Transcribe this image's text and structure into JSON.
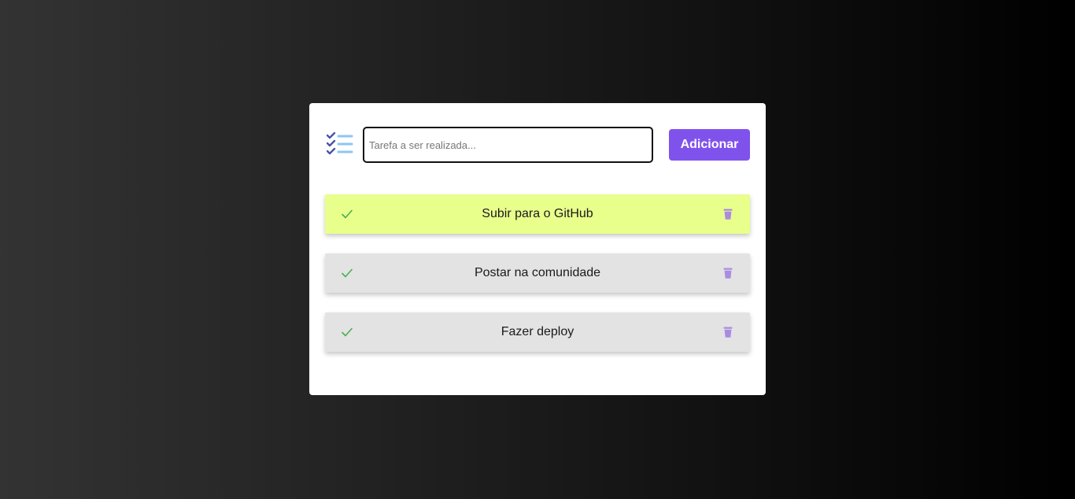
{
  "form": {
    "input_value": "",
    "input_placeholder": "Tarefa a ser realizada...",
    "add_label": "Adicionar"
  },
  "tasks": [
    {
      "text": "Subir para o GitHub",
      "done": true
    },
    {
      "text": "Postar na comunidade",
      "done": false
    },
    {
      "text": "Fazer deploy",
      "done": false
    }
  ],
  "colors": {
    "accent": "#8052ec",
    "done_background": "#e8ff8c",
    "task_background": "#e3e3e3",
    "check": "#4caf50",
    "trash": "#a98ce0",
    "logo_check": "#4a55a8",
    "logo_lines": "#8ec5f5"
  },
  "icons": {
    "logo": "checklist-icon",
    "task_complete": "check-icon",
    "task_delete": "trash-icon"
  }
}
